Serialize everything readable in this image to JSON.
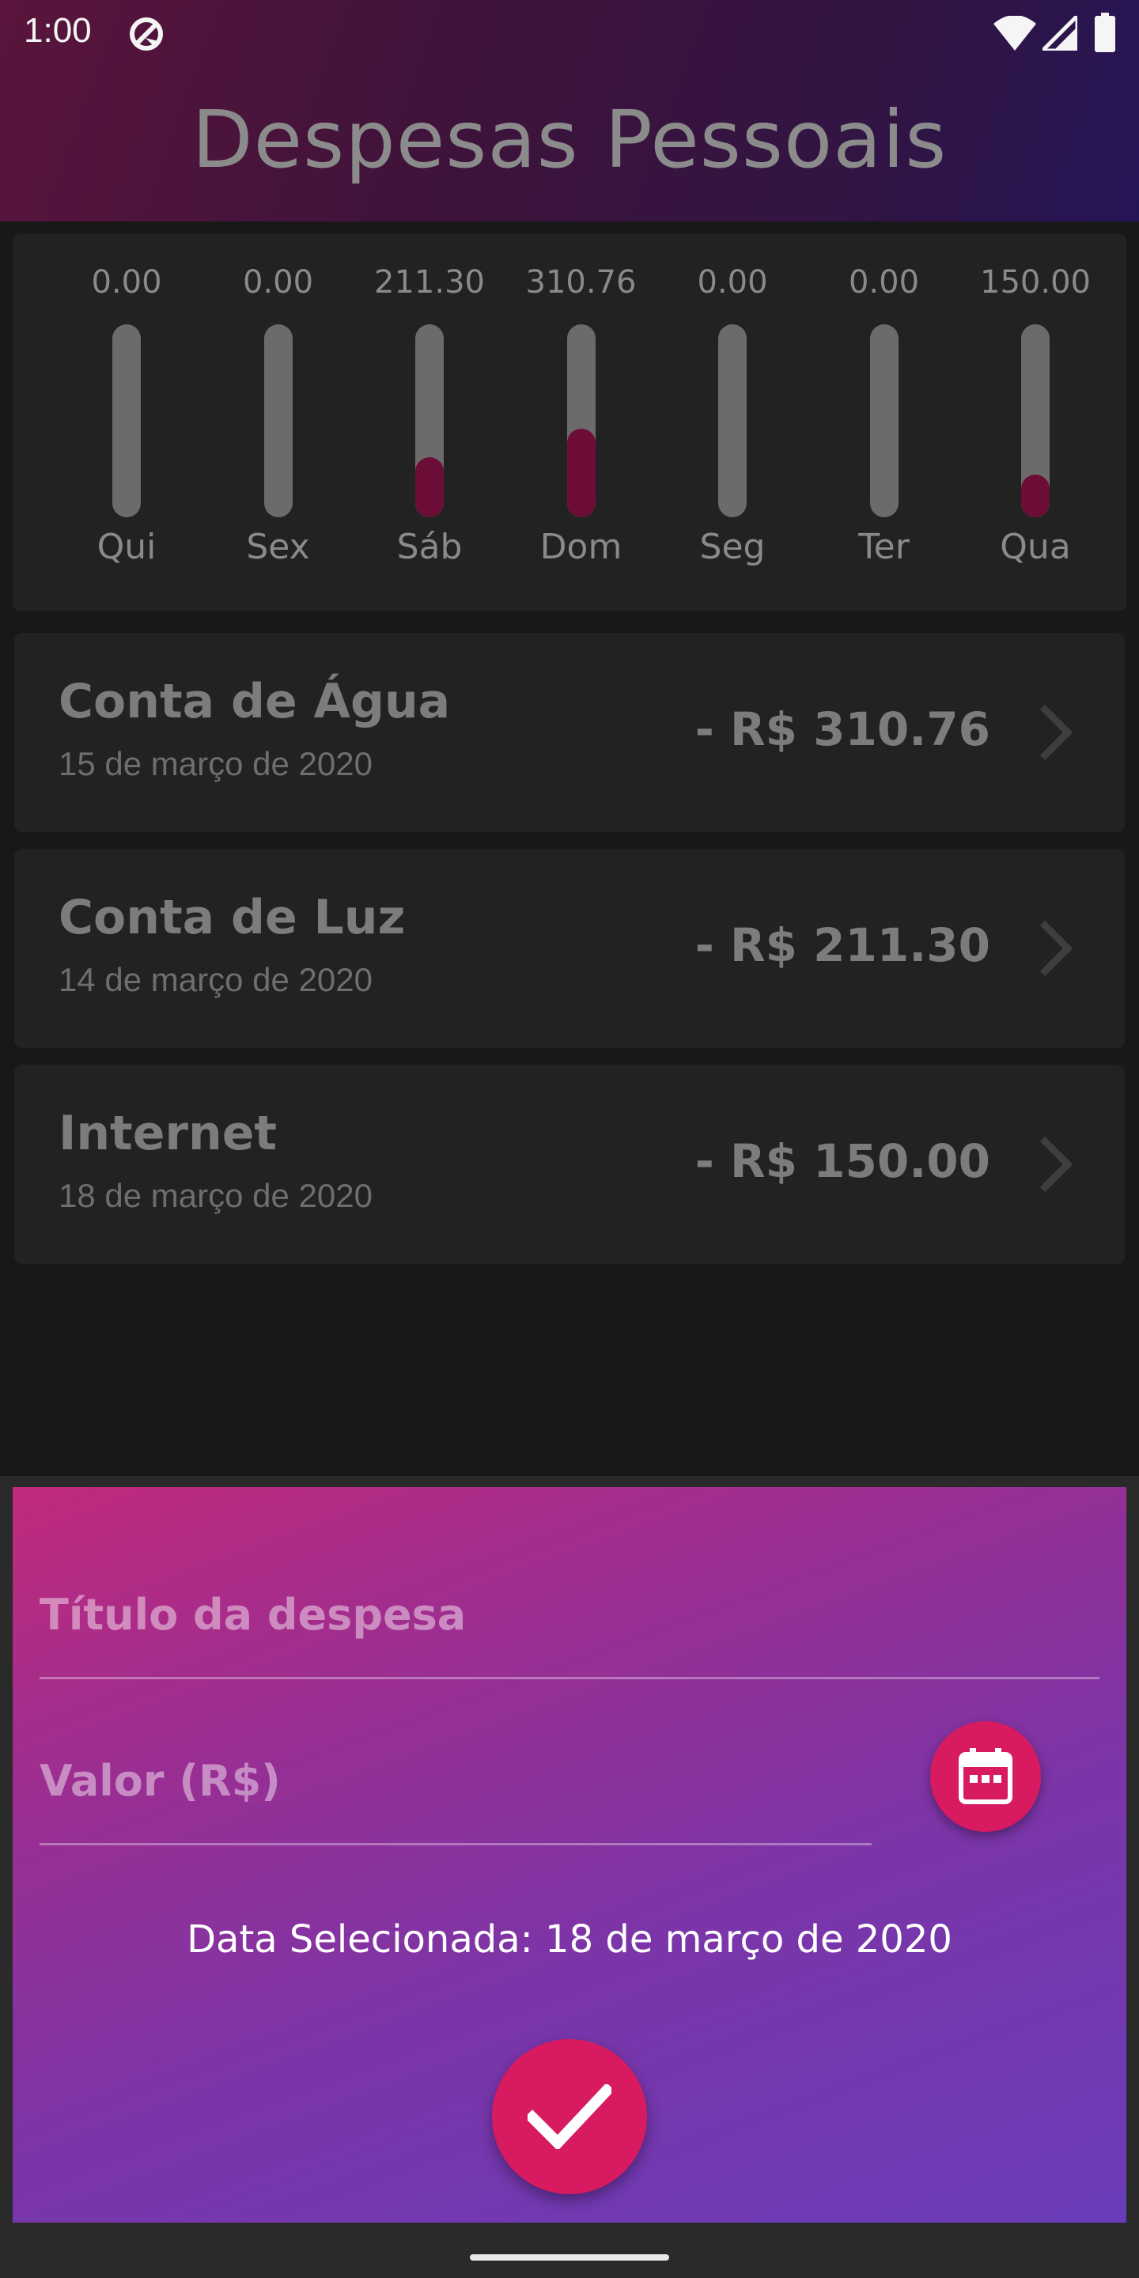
{
  "status_bar": {
    "time": "1:00"
  },
  "app": {
    "title": "Despesas Pessoais"
  },
  "chart_data": {
    "type": "bar",
    "categories": [
      "Qui",
      "Sex",
      "Sáb",
      "Dom",
      "Seg",
      "Ter",
      "Qua"
    ],
    "values": [
      0.0,
      0.0,
      211.3,
      310.76,
      0.0,
      0.0,
      150.0
    ],
    "value_labels": [
      "0.00",
      "0.00",
      "211.30",
      "310.76",
      "0.00",
      "0.00",
      "150.00"
    ],
    "fill_fraction": [
      0,
      0,
      0.31,
      0.46,
      0,
      0,
      0.22
    ],
    "colors": {
      "track": "#6b6b6b",
      "fill": "#6b0d37"
    }
  },
  "transactions": [
    {
      "title": "Conta de Água",
      "date": "15 de março de 2020",
      "amount": "- R$ 310.76"
    },
    {
      "title": "Conta de Luz",
      "date": "14 de março de 2020",
      "amount": "- R$ 211.30"
    },
    {
      "title": "Internet",
      "date": "18 de março de 2020",
      "amount": "- R$ 150.00"
    }
  ],
  "form": {
    "title_placeholder": "Título da despesa",
    "value_placeholder": "Valor (R$)",
    "selected_date": "Data Selecionada: 18 de março de 2020",
    "calendar_icon": "calendar-icon",
    "confirm_icon": "check-icon",
    "accent_color": "#d81b60"
  }
}
